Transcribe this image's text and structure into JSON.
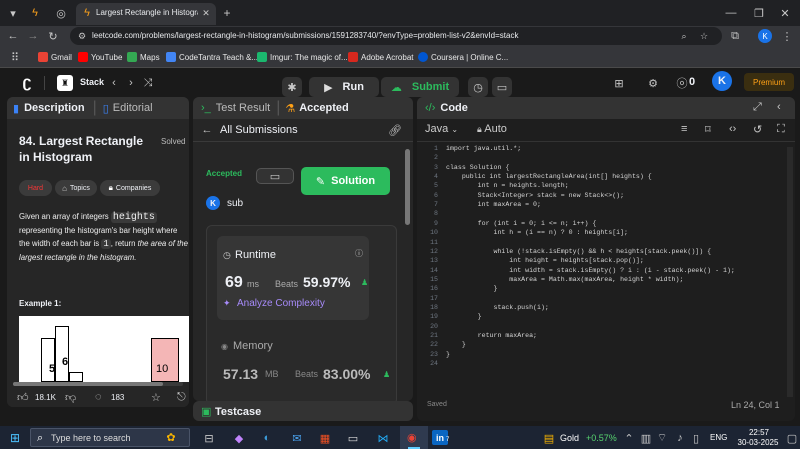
{
  "browser": {
    "tab_title": "Largest Rectangle in Histogram",
    "url": "leetcode.com/problems/largest-rectangle-in-histogram/submissions/1591283740/?envType=problem-list-v2&envId=stack",
    "profile_initial": "K",
    "bookmarks": [
      "Gmail",
      "YouTube",
      "Maps",
      "CodeTantra Teach &...",
      "Imgur: The magic of...",
      "Adobe Acrobat",
      "Coursera | Online C..."
    ],
    "bookmark_colors": [
      "#ea4335",
      "#ff0000",
      "#34a853",
      "#4285f4",
      "#1bb76e",
      "#d7281e",
      "#0056d2"
    ]
  },
  "lc_nav": {
    "list_name": "Stack",
    "run_label": "Run",
    "submit_label": "Submit",
    "streak": "0",
    "avatar": "K",
    "premium": "Premium"
  },
  "left_panel": {
    "tab_description": "Description",
    "tab_editorial": "Editorial",
    "title": "84. Largest Rectangle in Histogram",
    "solved": "Solved",
    "tags": [
      "Hard",
      "Topics",
      "Companies"
    ],
    "desc_pre": "Given an array of integers ",
    "desc_code": "heights",
    "desc_mid": " representing the histogram's bar height where the width of each bar is ",
    "desc_code2": "1",
    "desc_post": ", return ",
    "desc_em": "the area of the largest rectangle in the histogram.",
    "example_label": "Example 1:",
    "bar_labels": [
      "5",
      "6",
      "10"
    ],
    "likes": "18.1K",
    "comments": "183"
  },
  "mid_panel": {
    "tab_test": "Test Result",
    "tab_accepted": "Accepted",
    "all_submissions": "All Submissions",
    "status": "Accepted",
    "solution_label": "Solution",
    "user_initial": "K",
    "user_name": "sub",
    "runtime_label": "Runtime",
    "runtime_value": "69",
    "runtime_unit": "ms",
    "beats_label": "Beats",
    "runtime_beats": "59.97%",
    "analyze": "Analyze Complexity",
    "memory_label": "Memory",
    "memory_value": "57.13",
    "memory_unit": "MB",
    "memory_beats": "83.00%",
    "testcase_tab": "Testcase"
  },
  "code_panel": {
    "title": "Code",
    "language": "Java",
    "mode": "Auto",
    "status": "Saved",
    "cursor": "Ln 24, Col 1",
    "lines": [
      "import java.util.*;",
      "",
      "class Solution {",
      "    public int largestRectangleArea(int[] heights) {",
      "        int n = heights.length;",
      "        Stack<Integer> stack = new Stack<>();",
      "        int maxArea = 0;",
      "",
      "        for (int i = 0; i <= n; i++) {",
      "            int h = (i == n) ? 0 : heights[i];",
      "",
      "            while (!stack.isEmpty() && h < heights[stack.peek()]) {",
      "                int height = heights[stack.pop()];",
      "                int width = stack.isEmpty() ? i : (i - stack.peek() - 1);",
      "                maxArea = Math.max(maxArea, height * width);",
      "            }",
      "",
      "            stack.push(i);",
      "        }",
      "",
      "        return maxArea;",
      "    }",
      "}",
      ""
    ]
  },
  "taskbar": {
    "search": "Type here to search",
    "ticker": "Gold",
    "change": "+0.57%",
    "lang": "ENG",
    "time": "22:57",
    "date": "30-03-2025",
    "badge": "7"
  }
}
